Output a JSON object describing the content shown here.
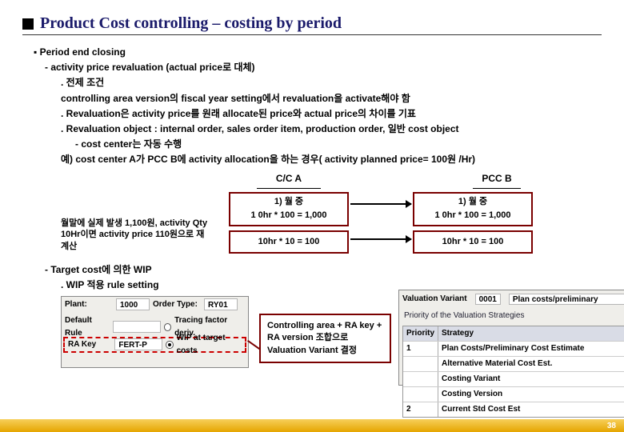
{
  "title": "Product Cost controlling – costing by period",
  "pagenum": "38",
  "bullets": {
    "lv1": "▪ Period end closing",
    "lv2_1": "- activity price revaluation (actual price로 대체)",
    "lv3_1": ". 전제 조건",
    "lv3_2": "controlling area version의 fiscal year setting에서 revaluation을 activate해야 함",
    "lv3_3": ". Revaluation은 activity price를 원래 allocate된 price와 actual price의 차이를 기표",
    "lv3_4": ". Revaluation object : internal order, sales order item, production order, 일반 cost object",
    "lv4_1": "- cost center는 자동 수행",
    "lv3_5": "예) cost center A가 PCC B에 activity allocation을 하는 경우( activity planned price= 100원 /Hr)"
  },
  "diagram": {
    "col_a": "C/C A",
    "col_b": "PCC B",
    "a1": "1) 월 중\n1 0hr * 100 = 1,000",
    "b1": "1) 월 중\n1 0hr * 100 = 1,000",
    "a2": "10hr * 10 = 100",
    "b2": "10hr * 10 = 100",
    "note": "월말에 실제 발생 1,100원, activity Qty 10Hr이면 activity price 110원으로 재계산"
  },
  "wip": {
    "l1": "- Target cost에 의한 WIP",
    "l2": ". WIP 적용 rule setting"
  },
  "sap_left": {
    "plant_lbl": "Plant:",
    "plant_val": "1000",
    "ordertype_lbl": "Order Type:",
    "ordertype_val": "RY01",
    "default_lbl": "Default Rule",
    "rakey_lbl": "RA Key",
    "rakey_val": "FERT-P",
    "opt1": "Tracing factor deriv.",
    "opt2": "WIP at target costs"
  },
  "callout": "Controlling area + RA key + RA version 조합으로 Valuation Variant 결정",
  "sap_right": {
    "vv_lbl": "Valuation Variant",
    "vv_val": "0001",
    "vv_desc": "Plan costs/preliminary",
    "caption": "Priority of the Valuation Strategies",
    "h1": "Priority",
    "h2": "Strategy",
    "r1p": "1",
    "r1s": "Plan Costs/Preliminary Cost Estimate",
    "r2p": "",
    "r2s": "Alternative Material Cost Est.",
    "r3p": "",
    "r3s": "Costing Variant",
    "r4p": "",
    "r4s": "Costing Version",
    "r5p": "2",
    "r5s": "Current Std Cost Est"
  }
}
